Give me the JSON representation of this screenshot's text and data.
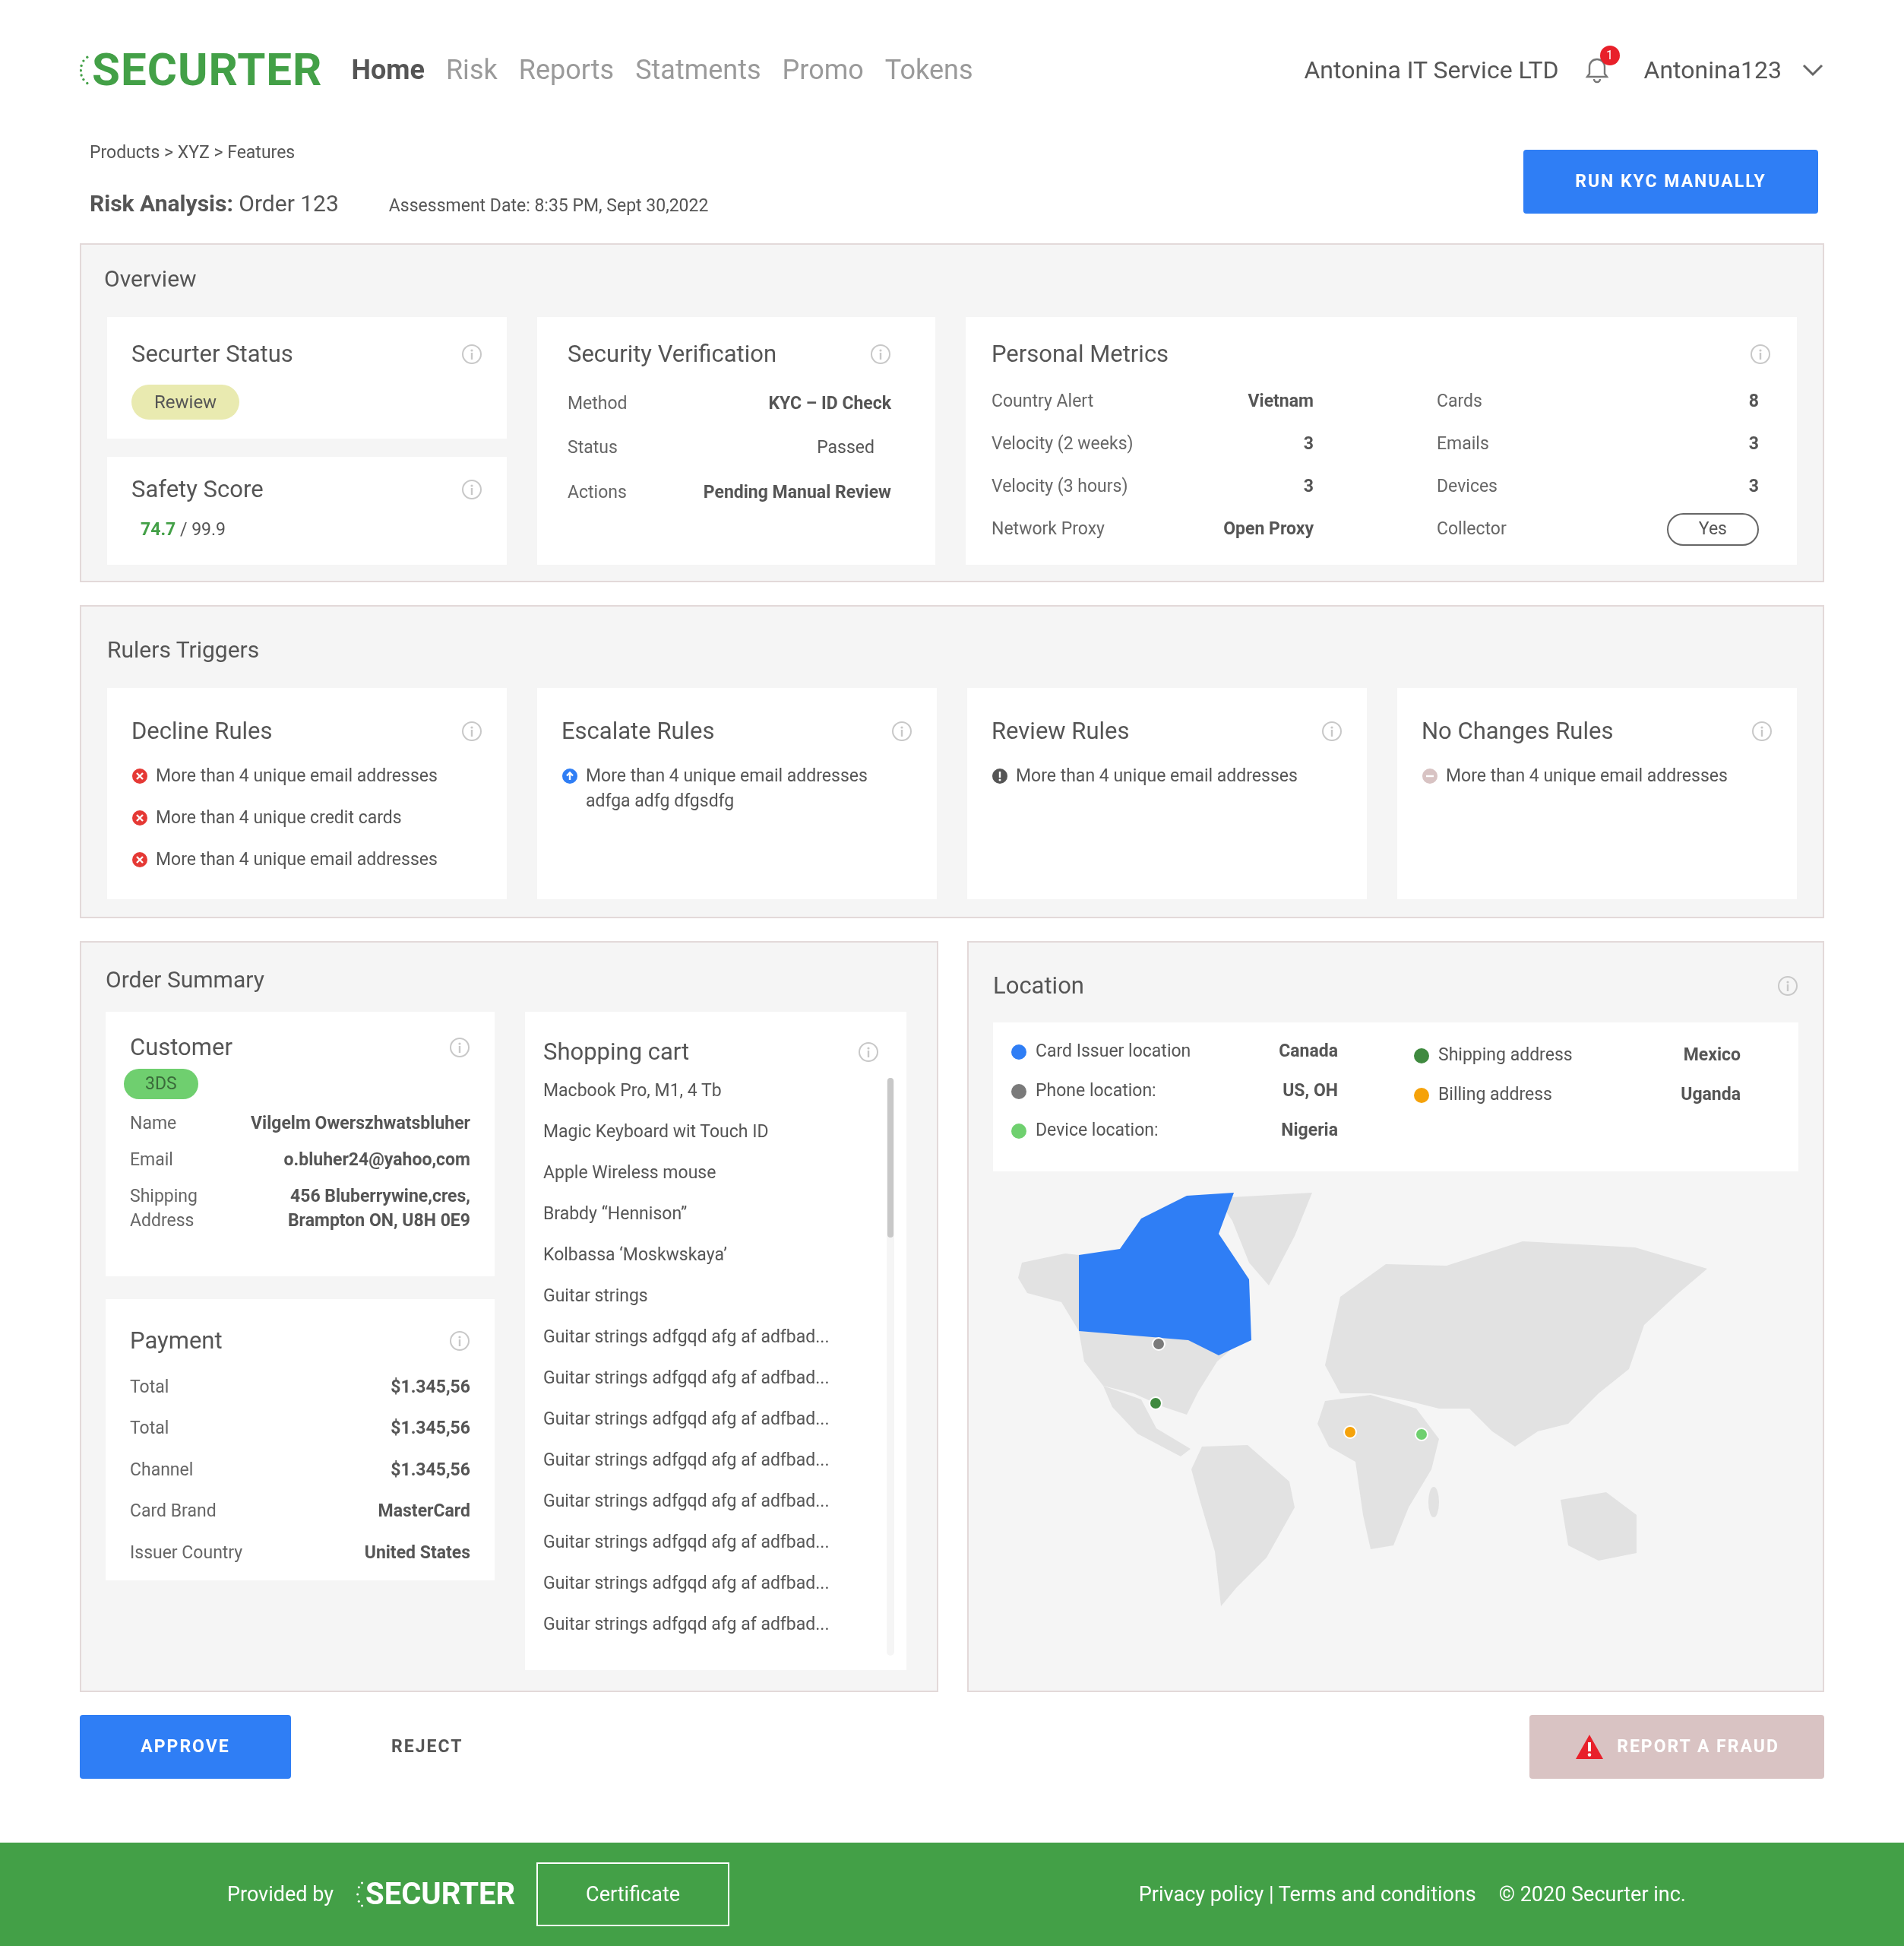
{
  "header": {
    "logo": "SECURTER",
    "nav": [
      {
        "label": "Home",
        "selected": true
      },
      {
        "label": "Risk",
        "selected": false
      },
      {
        "label": "Reports",
        "selected": false
      },
      {
        "label": "Statments",
        "selected": false
      },
      {
        "label": "Promo",
        "selected": false
      },
      {
        "label": "Tokens",
        "selected": false
      }
    ],
    "company": "Antonina IT Service LTD",
    "notifications": "1",
    "user": "Antonina123"
  },
  "breadcrumb": "Products > XYZ > Features",
  "title": {
    "label": "Risk Analysis:",
    "value": "Order 123",
    "assessment": "Assessment Date: 8:35 PM, Sept 30,2022"
  },
  "run_kyc_button": "RUN KYC MANUALLY",
  "overview": {
    "title": "Overview",
    "status": {
      "title": "Securter Status",
      "badge": "Rewiew"
    },
    "safety": {
      "title": "Safety Score",
      "score": "74.7",
      "max": "/ 99.9"
    },
    "verification": {
      "title": "Security Verification",
      "rows": [
        {
          "label": "Method",
          "value": "KYC – ID Check",
          "bold": true
        },
        {
          "label": "Status",
          "value": "Passed",
          "bold": false
        },
        {
          "label": "Actions",
          "value": "Pending Manual Review",
          "bold": true
        }
      ]
    },
    "metrics": {
      "title": "Personal Metrics",
      "left": [
        {
          "label": "Country Alert",
          "value": "Vietnam",
          "kind": "text"
        },
        {
          "label": "Velocity (2 weeks)",
          "value": "3",
          "kind": "text"
        },
        {
          "label": "Velocity (3 hours)",
          "value": "3",
          "kind": "text"
        },
        {
          "label": "Network Proxy",
          "value": "Open Proxy",
          "kind": "text"
        }
      ],
      "right": [
        {
          "label": "Cards",
          "value": "8",
          "kind": "text"
        },
        {
          "label": "Emails",
          "value": "3",
          "kind": "text"
        },
        {
          "label": "Devices",
          "value": "3",
          "kind": "text"
        },
        {
          "label": "Collector",
          "value": "Yes",
          "kind": "pill"
        }
      ]
    }
  },
  "rules": {
    "title": "Rulers Triggers",
    "groups": [
      {
        "title": "Decline Rules",
        "kind": "decline",
        "items": [
          "More than 4 unique email addresses",
          "More than 4 unique credit cards",
          "More than 4 unique email addresses"
        ]
      },
      {
        "title": "Escalate Rules",
        "kind": "escalate",
        "items": [
          "More than 4 unique email addresses adfga adfg dfgsdfg"
        ]
      },
      {
        "title": "Review Rules",
        "kind": "review",
        "items": [
          "More than 4 unique email addresses"
        ]
      },
      {
        "title": "No Changes Rules",
        "kind": "none",
        "items": [
          "More than 4 unique email addresses"
        ]
      }
    ]
  },
  "order_summary": {
    "title": "Order Summary",
    "customer": {
      "title": "Customer",
      "badge": "3DS",
      "rows": [
        {
          "label": "Name",
          "value": "Vilgelm Owerszhwatsbluher"
        },
        {
          "label": "Email",
          "value": "o.bluher24@yahoo,com"
        },
        {
          "label": "Shipping Address",
          "value": "456 Bluberrywine,cres, Brampton ON, U8H 0E9"
        }
      ]
    },
    "payment": {
      "title": "Payment",
      "rows": [
        {
          "label": "Total",
          "value": "$1.345,56"
        },
        {
          "label": "Total",
          "value": "$1.345,56"
        },
        {
          "label": "Channel",
          "value": "$1.345,56"
        },
        {
          "label": "Card Brand",
          "value": "MasterCard"
        },
        {
          "label": "Issuer Country",
          "value": "United States"
        }
      ]
    },
    "cart": {
      "title": "Shopping cart",
      "items": [
        "Macbook Pro, M1, 4 Tb",
        "Magic Keyboard wit Touch ID",
        "Apple Wireless mouse",
        "Brabdy “Hennison”",
        "Kolbassa ‘Moskwskaya’",
        "Guitar strings",
        "Guitar strings adfgqd afg af adfbad...",
        "Guitar strings adfgqd afg af adfbad...",
        "Guitar strings adfgqd afg af adfbad...",
        "Guitar strings adfgqd afg af adfbad...",
        "Guitar strings adfgqd afg af adfbad...",
        "Guitar strings adfgqd afg af adfbad...",
        "Guitar strings adfgqd afg af adfbad...",
        "Guitar strings adfgqd afg af adfbad..."
      ]
    }
  },
  "location": {
    "title": "Location",
    "left_items": [
      {
        "label": "Card Issuer location",
        "value": "Canada",
        "color": "#2f7ef5"
      },
      {
        "label": "Phone location:",
        "value": "US, OH",
        "color": "#7a7a7a"
      },
      {
        "label": "Device location:",
        "value": "Nigeria",
        "color": "#6fd06f"
      }
    ],
    "right_items": [
      {
        "label": "Shipping address",
        "value": "Mexico",
        "color": "#3f8a3f"
      },
      {
        "label": "Billing address",
        "value": "Uganda",
        "color": "#f5a20a"
      }
    ]
  },
  "actions": {
    "approve": "APPROVE",
    "reject": "REJECT",
    "report": "REPORT A FRAUD"
  },
  "footer": {
    "provided_by": "Provided by",
    "logo": "SECURTER",
    "certificate": "Certificate",
    "links": "Privacy policy | Terms and conditions",
    "copyright": "© 2020 Securter inc."
  }
}
